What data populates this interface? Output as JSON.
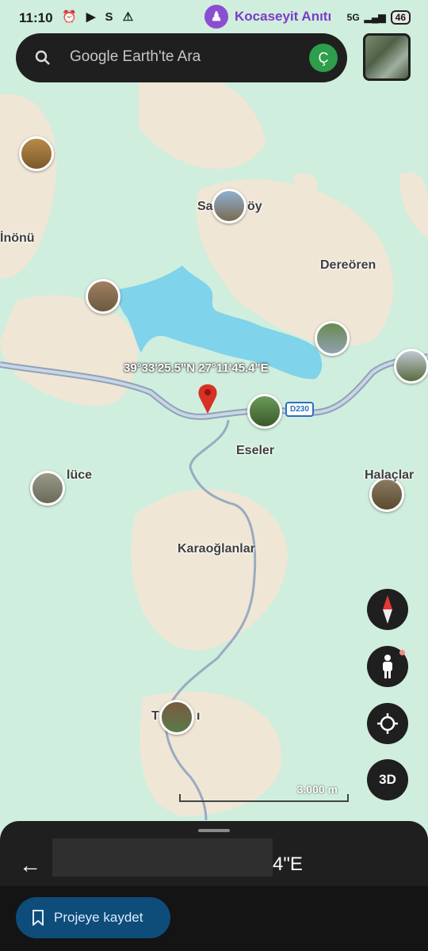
{
  "status_bar": {
    "time": "11:10",
    "icons": "⏰ ▶ S ⚠",
    "notification_text": "Kocaseyit Anıtı",
    "signal": "5G",
    "battery": "46"
  },
  "search": {
    "placeholder": "Google Earth'te Ara",
    "avatar_letter": "Ç"
  },
  "map": {
    "coordinates": "39°33'25.5\"N 27°11'45.4\"E",
    "road_label": "D230",
    "places": [
      "Sa",
      "öy",
      "İnönü",
      "Dereören",
      "Eseler",
      "Halaçlar",
      "lüce",
      "Karaoğlanlar",
      "T",
      "ı"
    ],
    "scale_label": "3.000 m",
    "colors": {
      "land": "#cfeedd",
      "water": "#7fd3ea",
      "road": "#8fa2b8",
      "pin": "#d93025",
      "sand": "#efe6d6"
    }
  },
  "controls": {
    "compass_icon": "compass-icon",
    "streetview_icon": "person-icon",
    "location_icon": "crosshair-icon",
    "mode_label": "3D"
  },
  "sheet": {
    "title_partial": "4\"E",
    "save_label": "Projeye kaydet"
  }
}
